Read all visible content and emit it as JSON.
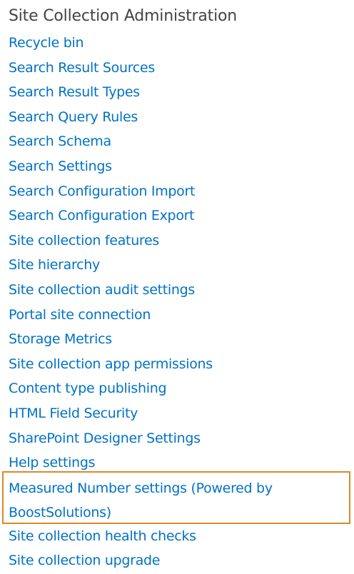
{
  "section": {
    "title": "Site Collection Administration"
  },
  "links": [
    {
      "label": "Recycle bin"
    },
    {
      "label": "Search Result Sources"
    },
    {
      "label": "Search Result Types"
    },
    {
      "label": "Search Query Rules"
    },
    {
      "label": "Search Schema"
    },
    {
      "label": "Search Settings"
    },
    {
      "label": "Search Configuration Import"
    },
    {
      "label": "Search Configuration Export"
    },
    {
      "label": "Site collection features"
    },
    {
      "label": "Site hierarchy"
    },
    {
      "label": "Site collection audit settings"
    },
    {
      "label": "Portal site connection"
    },
    {
      "label": "Storage Metrics"
    },
    {
      "label": "Site collection app permissions"
    },
    {
      "label": "Content type publishing"
    },
    {
      "label": "HTML Field Security"
    },
    {
      "label": "SharePoint Designer Settings"
    },
    {
      "label": "Help settings"
    },
    {
      "label": "Measured Number settings (Powered by BoostSolutions)",
      "highlighted": true
    },
    {
      "label": "Site collection health checks"
    },
    {
      "label": "Site collection upgrade"
    }
  ],
  "colors": {
    "link": "#0072c6",
    "title": "#444444",
    "highlight_border": "#d98a2b"
  }
}
